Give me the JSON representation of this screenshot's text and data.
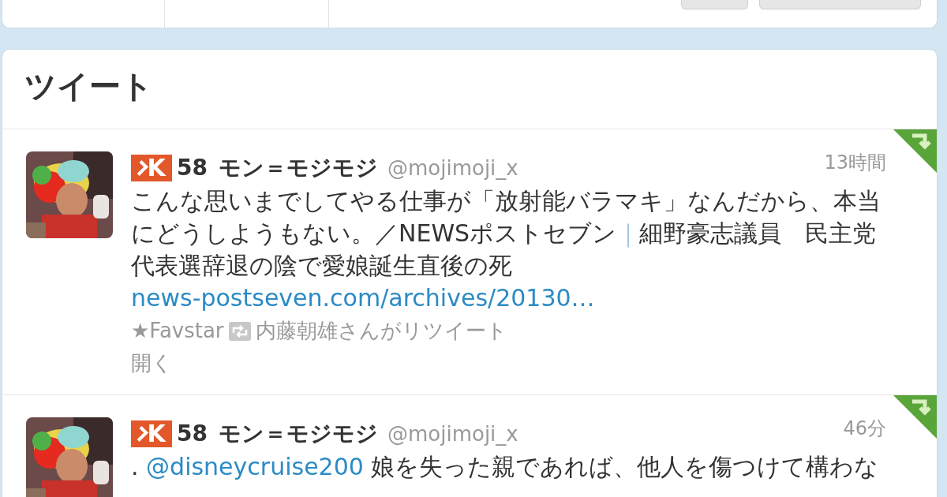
{
  "timeline": {
    "title": "ツイート",
    "tweets": [
      {
        "klout_logo": "K",
        "klout_score": "58",
        "name": "モン＝モジモジ",
        "handle": "@mojimoji_x",
        "time": "13時間",
        "body": [
          {
            "kind": "text",
            "text": "こんな思いまでしてやる仕事が「放射能バラマキ」なんだから、本当にどうしようもない。／NEWSポストセブン"
          },
          {
            "kind": "separator",
            "text": "｜"
          },
          {
            "kind": "text",
            "text": "細野豪志議員　民主党代表選辞退の陰で愛娘誕生直後の死"
          },
          {
            "kind": "link",
            "text": "news-postseven.com/archives/20130…"
          }
        ],
        "favstar": "★Favstar",
        "retweeted_by": "内藤朝雄さんがリツイート",
        "expand": "開く"
      },
      {
        "klout_logo": "K",
        "klout_score": "58",
        "name": "モン＝モジモジ",
        "handle": "@mojimoji_x",
        "time": "46分",
        "body": [
          {
            "kind": "text",
            "text": "."
          },
          {
            "kind": "link",
            "text": "@disneycruise200"
          },
          {
            "kind": "text",
            "text": "娘を失った親であれば、他人を傷つけて構わな"
          }
        ]
      }
    ]
  }
}
